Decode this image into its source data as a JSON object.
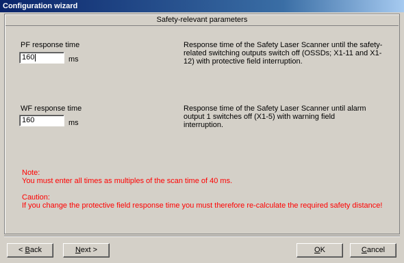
{
  "window": {
    "title": "Configuration wizard"
  },
  "section": {
    "title": "Safety-relevant parameters"
  },
  "pf": {
    "label": "PF response time",
    "value": "160",
    "unit": "ms",
    "description": "Response time of the Safety Laser Scanner until the safety-related switching outputs switch off (OSSDs; X1-11 and X1-12) with protective field interruption."
  },
  "wf": {
    "label": "WF response time",
    "value": "160",
    "unit": "ms",
    "description": "Response time of the Safety Laser Scanner until alarm output 1 switches off (X1-5) with warning field interruption."
  },
  "note": {
    "title": "Note:",
    "text": "You must enter all times as multiples of the scan time of 40 ms."
  },
  "caution": {
    "title": "Caution:",
    "text": "If you change the protective field response time you must therefore re-calculate the required safety distance!"
  },
  "buttons": {
    "back": {
      "prefix": "< ",
      "mnemonic": "B",
      "rest": "ack"
    },
    "next": {
      "mnemonic": "N",
      "rest": "ext",
      "suffix": " >"
    },
    "ok": {
      "mnemonic": "O",
      "rest": "K"
    },
    "cancel": {
      "mnemonic": "C",
      "rest": "ancel"
    }
  },
  "colors": {
    "warning_text": "#ff0000",
    "title_bar": "#0a246a",
    "dialog_bg": "#d4d0c8"
  }
}
